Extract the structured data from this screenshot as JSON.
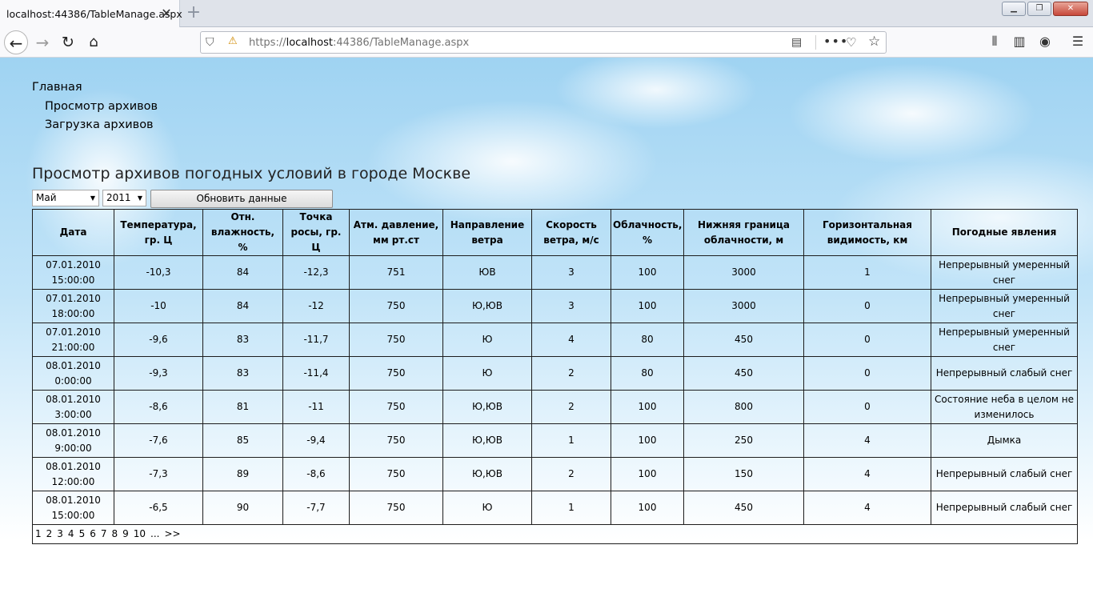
{
  "browser": {
    "tab_title": "localhost:44386/TableManage.aspx",
    "tab_close": "✕",
    "new_tab": "+",
    "url_scheme": "https://",
    "url_host": "localhost",
    "url_rest": ":44386/TableManage.aspx"
  },
  "menu": {
    "home": "Главная",
    "view_archives": "Просмотр архивов",
    "upload_archives": "Загрузка архивов"
  },
  "page_title": "Просмотр архивов погодных условий в городе Москве",
  "controls": {
    "month": "Май",
    "year": "2011",
    "update_button": "Обновить данные"
  },
  "table": {
    "headers": [
      "Дата",
      "Температура, гр. Ц",
      "Отн. влажность, %",
      "Точка росы, гр. Ц",
      "Атм. давление, мм рт.ст",
      "Направление ветра",
      "Скорость ветра, м/с",
      "Облачность, %",
      "Нижняя граница облачности, м",
      "Горизонтальная видимость, км",
      "Погодные явления"
    ],
    "rows": [
      [
        "07.01.2010 15:00:00",
        "-10,3",
        "84",
        "-12,3",
        "751",
        "ЮВ",
        "3",
        "100",
        "3000",
        "1",
        "Непрерывный умеренный снег"
      ],
      [
        "07.01.2010 18:00:00",
        "-10",
        "84",
        "-12",
        "750",
        "Ю,ЮВ",
        "3",
        "100",
        "3000",
        "0",
        "Непрерывный умеренный снег"
      ],
      [
        "07.01.2010 21:00:00",
        "-9,6",
        "83",
        "-11,7",
        "750",
        "Ю",
        "4",
        "80",
        "450",
        "0",
        "Непрерывный умеренный снег"
      ],
      [
        "08.01.2010 0:00:00",
        "-9,3",
        "83",
        "-11,4",
        "750",
        "Ю",
        "2",
        "80",
        "450",
        "0",
        "Непрерывный слабый снег"
      ],
      [
        "08.01.2010 3:00:00",
        "-8,6",
        "81",
        "-11",
        "750",
        "Ю,ЮВ",
        "2",
        "100",
        "800",
        "0",
        "Состояние неба в целом не изменилось"
      ],
      [
        "08.01.2010 9:00:00",
        "-7,6",
        "85",
        "-9,4",
        "750",
        "Ю,ЮВ",
        "1",
        "100",
        "250",
        "4",
        "Дымка"
      ],
      [
        "08.01.2010 12:00:00",
        "-7,3",
        "89",
        "-8,6",
        "750",
        "Ю,ЮВ",
        "2",
        "100",
        "150",
        "4",
        "Непрерывный слабый снег"
      ],
      [
        "08.01.2010 15:00:00",
        "-6,5",
        "90",
        "-7,7",
        "750",
        "Ю",
        "1",
        "100",
        "450",
        "4",
        "Непрерывный слабый снег"
      ]
    ],
    "pager": [
      "1",
      "2",
      "3",
      "4",
      "5",
      "6",
      "7",
      "8",
      "9",
      "10",
      "...",
      ">>"
    ]
  }
}
